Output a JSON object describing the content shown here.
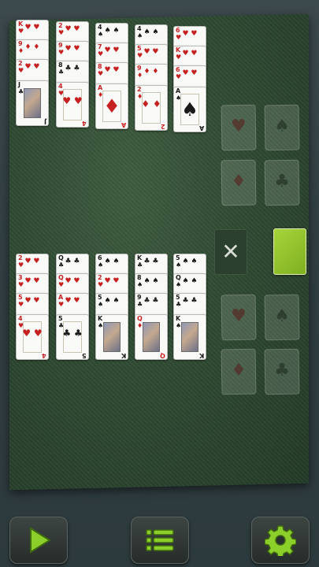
{
  "game": {
    "top_tableau": [
      [
        {
          "r": "K",
          "s": "♥",
          "c": "red"
        },
        {
          "r": "9",
          "s": "♦",
          "c": "red"
        },
        {
          "r": "2",
          "s": "♥",
          "c": "red"
        },
        {
          "r": "J",
          "s": "♣",
          "c": "blk",
          "face": true
        }
      ],
      [
        {
          "r": "2",
          "s": "♥",
          "c": "red"
        },
        {
          "r": "9",
          "s": "♥",
          "c": "red"
        },
        {
          "r": "8",
          "s": "♣",
          "c": "blk"
        },
        {
          "r": "4",
          "s": "♥",
          "c": "red"
        }
      ],
      [
        {
          "r": "4",
          "s": "♠",
          "c": "blk"
        },
        {
          "r": "7",
          "s": "♥",
          "c": "red"
        },
        {
          "r": "8",
          "s": "♥",
          "c": "red"
        },
        {
          "r": "A",
          "s": "♦",
          "c": "red",
          "ace": true
        }
      ],
      [
        {
          "r": "4",
          "s": "♠",
          "c": "blk"
        },
        {
          "r": "5",
          "s": "♥",
          "c": "red"
        },
        {
          "r": "9",
          "s": "♦",
          "c": "red"
        },
        {
          "r": "2",
          "s": "♦",
          "c": "red"
        }
      ],
      [
        {
          "r": "6",
          "s": "♥",
          "c": "red"
        },
        {
          "r": "K",
          "s": "♥",
          "c": "red"
        },
        {
          "r": "6",
          "s": "♥",
          "c": "red"
        },
        {
          "r": "A",
          "s": "♠",
          "c": "blk",
          "ace": true
        }
      ]
    ],
    "bottom_tableau": [
      [
        {
          "r": "2",
          "s": "♥",
          "c": "red"
        },
        {
          "r": "3",
          "s": "♥",
          "c": "red"
        },
        {
          "r": "5",
          "s": "♥",
          "c": "red"
        },
        {
          "r": "4",
          "s": "♥",
          "c": "red"
        }
      ],
      [
        {
          "r": "Q",
          "s": "♣",
          "c": "blk"
        },
        {
          "r": "Q",
          "s": "♥",
          "c": "red"
        },
        {
          "r": "A",
          "s": "♥",
          "c": "red"
        },
        {
          "r": "5",
          "s": "♣",
          "c": "blk"
        }
      ],
      [
        {
          "r": "6",
          "s": "♠",
          "c": "blk"
        },
        {
          "r": "2",
          "s": "♥",
          "c": "red"
        },
        {
          "r": "5",
          "s": "♠",
          "c": "blk"
        },
        {
          "r": "K",
          "s": "♠",
          "c": "blk",
          "face": true
        }
      ],
      [
        {
          "r": "K",
          "s": "♣",
          "c": "blk"
        },
        {
          "r": "8",
          "s": "♠",
          "c": "blk"
        },
        {
          "r": "9",
          "s": "♣",
          "c": "blk"
        },
        {
          "r": "Q",
          "s": "♦",
          "c": "red",
          "face": true
        }
      ],
      [
        {
          "r": "5",
          "s": "♠",
          "c": "blk"
        },
        {
          "r": "Q",
          "s": "♠",
          "c": "blk"
        },
        {
          "r": "5",
          "s": "♣",
          "c": "blk"
        },
        {
          "r": "K",
          "s": "♠",
          "c": "blk",
          "face": true
        }
      ]
    ],
    "foundations_top": [
      {
        "s": "♥",
        "c": "r"
      },
      {
        "s": "♠",
        "c": "b"
      },
      {
        "s": "♦",
        "c": "r"
      },
      {
        "s": "♣",
        "c": "b"
      }
    ],
    "foundations_bottom": [
      {
        "s": "♥",
        "c": "r"
      },
      {
        "s": "♠",
        "c": "b"
      },
      {
        "s": "♦",
        "c": "r"
      },
      {
        "s": "♣",
        "c": "b"
      }
    ],
    "discard_symbol": "✕"
  },
  "toolbar": {
    "play_icon": "play-icon",
    "menu_icon": "menu-icon",
    "settings_icon": "gear-icon",
    "accent": "#8ccf2a"
  }
}
